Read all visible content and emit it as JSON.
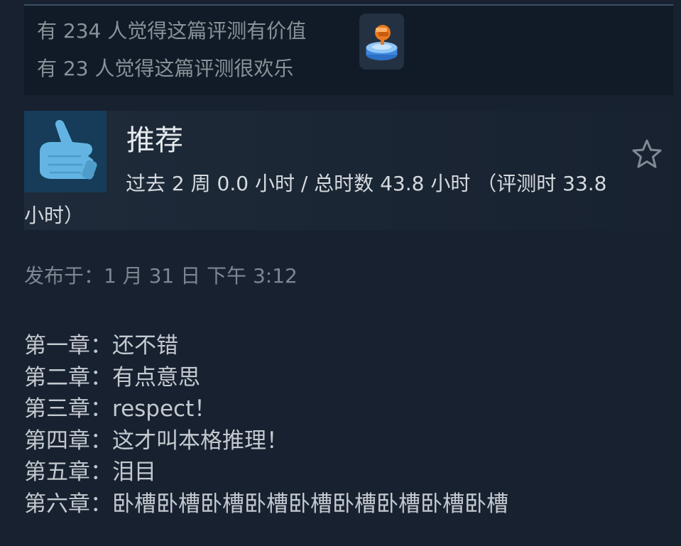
{
  "helpful": {
    "helpful_line": "有 234 人觉得这篇评测有价值",
    "funny_line": "有 23 人觉得这篇评测很欢乐",
    "award_icon": "award-trophy-icon"
  },
  "review": {
    "verdict": "推荐",
    "verdict_icon": "thumbs-up-icon",
    "hours": "过去 2 周 0.0 小时 / 总时数 43.8 小时 （评测时 33.8 小时）",
    "favorite_icon": "star-icon",
    "posted": "发布于：1 月 31 日 下午 3:12",
    "lines": [
      "第一章：还不错",
      "第二章：有点意思",
      "第三章：respect！",
      "第四章：这才叫本格推理！",
      "第五章：泪目",
      "第六章：卧槽卧槽卧槽卧槽卧槽卧槽卧槽卧槽卧槽"
    ]
  },
  "colors": {
    "background": "#172130",
    "panel": "#101b27",
    "thumb_bg": "#163c59",
    "thumb_fg": "#63b4e3",
    "muted_text": "#8a9299",
    "body_text": "#c4c9cf"
  }
}
